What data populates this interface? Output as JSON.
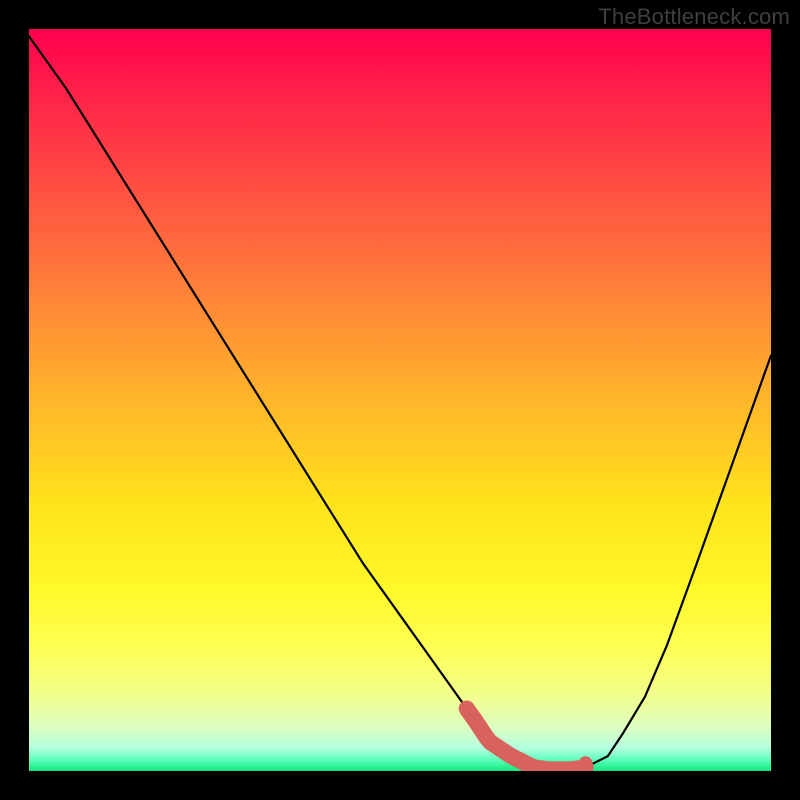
{
  "watermark": "TheBottleneck.com",
  "chart_data": {
    "type": "line",
    "title": "",
    "xlabel": "",
    "ylabel": "",
    "xlim": [
      0,
      100
    ],
    "ylim": [
      0,
      100
    ],
    "series": [
      {
        "name": "bottleneck-curve",
        "x": [
          0,
          5,
          10,
          15,
          20,
          25,
          30,
          35,
          40,
          45,
          50,
          55,
          60,
          62,
          65,
          68,
          70,
          73,
          75,
          78,
          80,
          83,
          86,
          90,
          95,
          100
        ],
        "y": [
          99,
          92,
          84,
          76,
          68,
          60,
          52,
          44,
          36,
          28,
          21,
          14,
          7,
          4,
          2,
          0.5,
          0.2,
          0.2,
          0.5,
          2,
          5,
          10,
          17,
          28,
          42,
          56
        ]
      }
    ],
    "highlight_band": {
      "x_start": 59,
      "x_end": 75,
      "color": "#d8635e",
      "thickness_pct": 2.2
    },
    "grid": false,
    "background_gradient": {
      "stops": [
        {
          "pos": 0.0,
          "color": "#ff004d"
        },
        {
          "pos": 0.2,
          "color": "#ff4943"
        },
        {
          "pos": 0.5,
          "color": "#ffb62a"
        },
        {
          "pos": 0.76,
          "color": "#fff92a"
        },
        {
          "pos": 0.94,
          "color": "#deffc0"
        },
        {
          "pos": 1.0,
          "color": "#12e77e"
        }
      ]
    }
  }
}
